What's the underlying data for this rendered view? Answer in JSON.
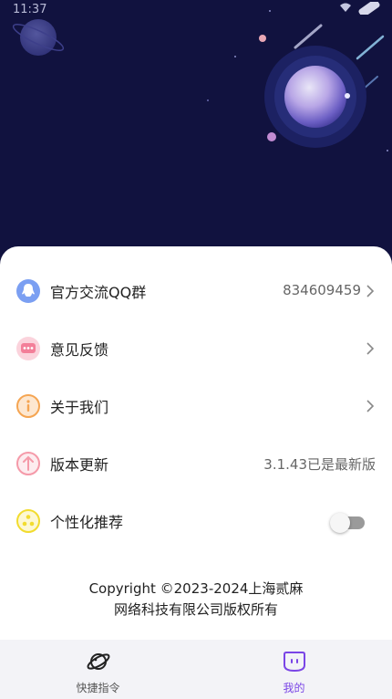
{
  "status_bar": {
    "time": "11:37"
  },
  "settings": [
    {
      "label": "官方交流QQ群",
      "value": "834609459",
      "icon": "qq-icon",
      "color": "#7b9ff2"
    },
    {
      "label": "意见反馈",
      "value": "",
      "icon": "feedback-icon",
      "color": "#f37f99"
    },
    {
      "label": "关于我们",
      "value": "",
      "icon": "info-icon",
      "color": "#f5a552"
    },
    {
      "label": "版本更新",
      "value": "3.1.43已是最新版",
      "icon": "update-icon",
      "color": "#f59aa9"
    },
    {
      "label": "个性化推荐",
      "value": "",
      "icon": "recommend-icon",
      "color": "#f2dc2f",
      "toggle_on": false
    }
  ],
  "copyright": {
    "line1": "Copyright ©2023-2024上海贰麻",
    "line2": "网络科技有限公司版权所有"
  },
  "tabbar": {
    "tabs": [
      {
        "label": "快捷指令",
        "icon": "planet-icon",
        "active": false
      },
      {
        "label": "我的",
        "icon": "face-icon",
        "active": true
      }
    ],
    "active_color": "#7a45e6",
    "inactive_color": "#555555"
  },
  "colors": {
    "hero_bg": "#11123f"
  }
}
